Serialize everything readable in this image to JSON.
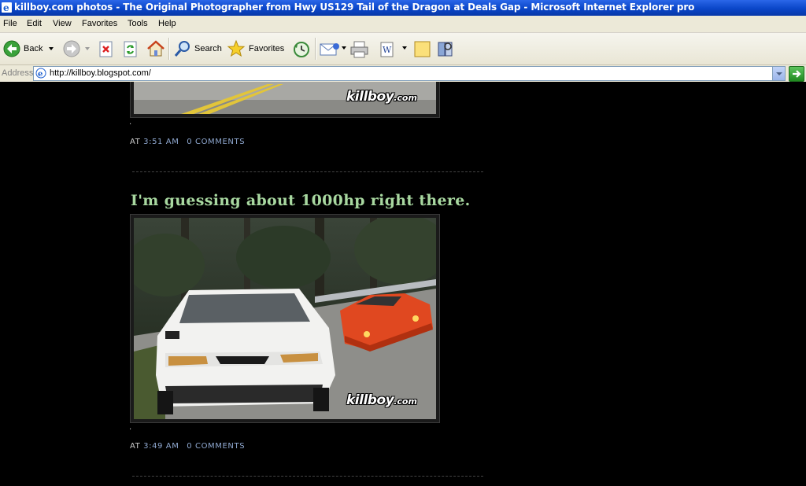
{
  "window": {
    "title": "killboy.com photos - The Original Photographer from Hwy US129 Tail of the Dragon at Deals Gap - Microsoft Internet Explorer pro"
  },
  "menu": [
    "File",
    "Edit",
    "View",
    "Favorites",
    "Tools",
    "Help"
  ],
  "toolbar": {
    "back_label": "Back",
    "search_label": "Search",
    "favorites_label": "Favorites"
  },
  "address": {
    "label": "Address",
    "url": "http://killboy.blogspot.com/"
  },
  "posts": [
    {
      "dot": ".",
      "at_label": "AT",
      "time": "3:51 AM",
      "comments": "0 COMMENTS",
      "watermark": {
        "brand": "killboy",
        "tld": ".com"
      }
    },
    {
      "title": "I'm guessing about 1000hp right there.",
      "dot": ".",
      "at_label": "AT",
      "time": "3:49 AM",
      "comments": "0 COMMENTS",
      "watermark": {
        "brand": "killboy",
        "tld": ".com"
      }
    }
  ],
  "colors": {
    "title_bar": "#0a46c8",
    "post_title": "#a8d8a0",
    "link": "#8fa8d0",
    "background": "#000000"
  },
  "icons": [
    "ie-icon",
    "back-icon",
    "forward-icon",
    "stop-icon",
    "refresh-icon",
    "home-icon",
    "search-icon",
    "favorites-star-icon",
    "history-icon",
    "mail-icon",
    "print-icon",
    "edit-icon",
    "messenger-icon",
    "research-icon",
    "page-icon",
    "go-icon"
  ]
}
